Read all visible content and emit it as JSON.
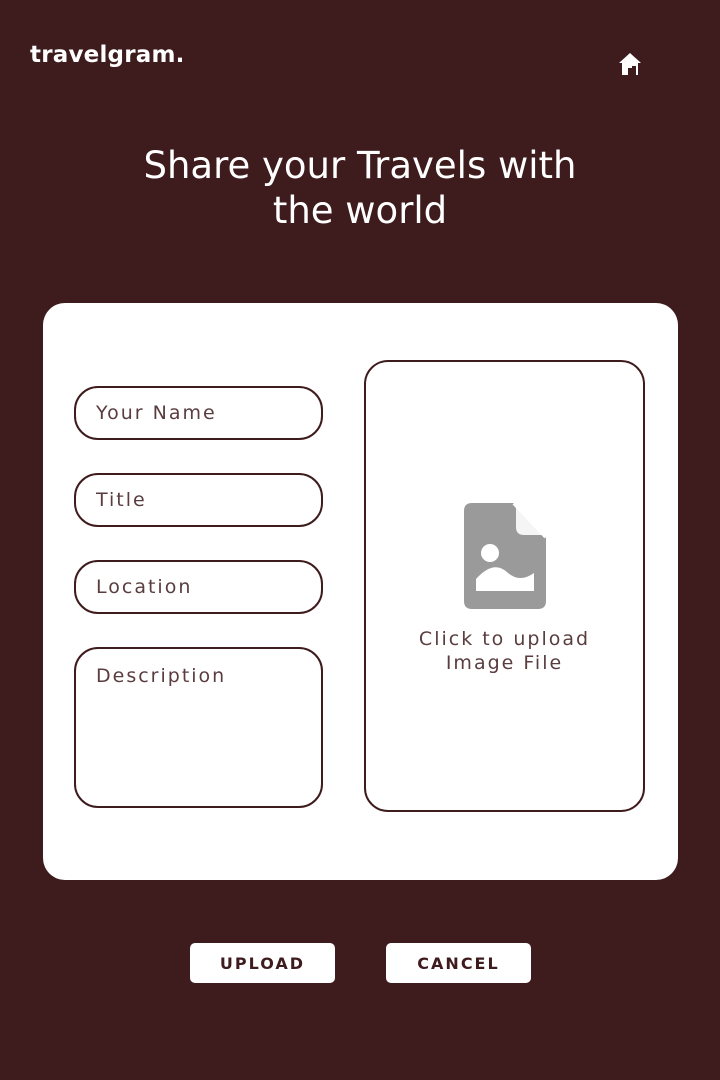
{
  "header": {
    "logo": "travelgram.",
    "home_icon": "home-icon"
  },
  "headline": "Share your Travels with the world",
  "form": {
    "name_placeholder": "Your Name",
    "title_placeholder": "Title",
    "location_placeholder": "Location",
    "description_placeholder": "Description",
    "upload_icon": "image-file-icon",
    "upload_text": "Click to upload Image File"
  },
  "actions": {
    "upload_label": "UPLOAD",
    "cancel_label": "CANCEL"
  },
  "colors": {
    "background": "#3e1b1d",
    "card": "#ffffff",
    "icon_gray": "#9a9a9a"
  }
}
